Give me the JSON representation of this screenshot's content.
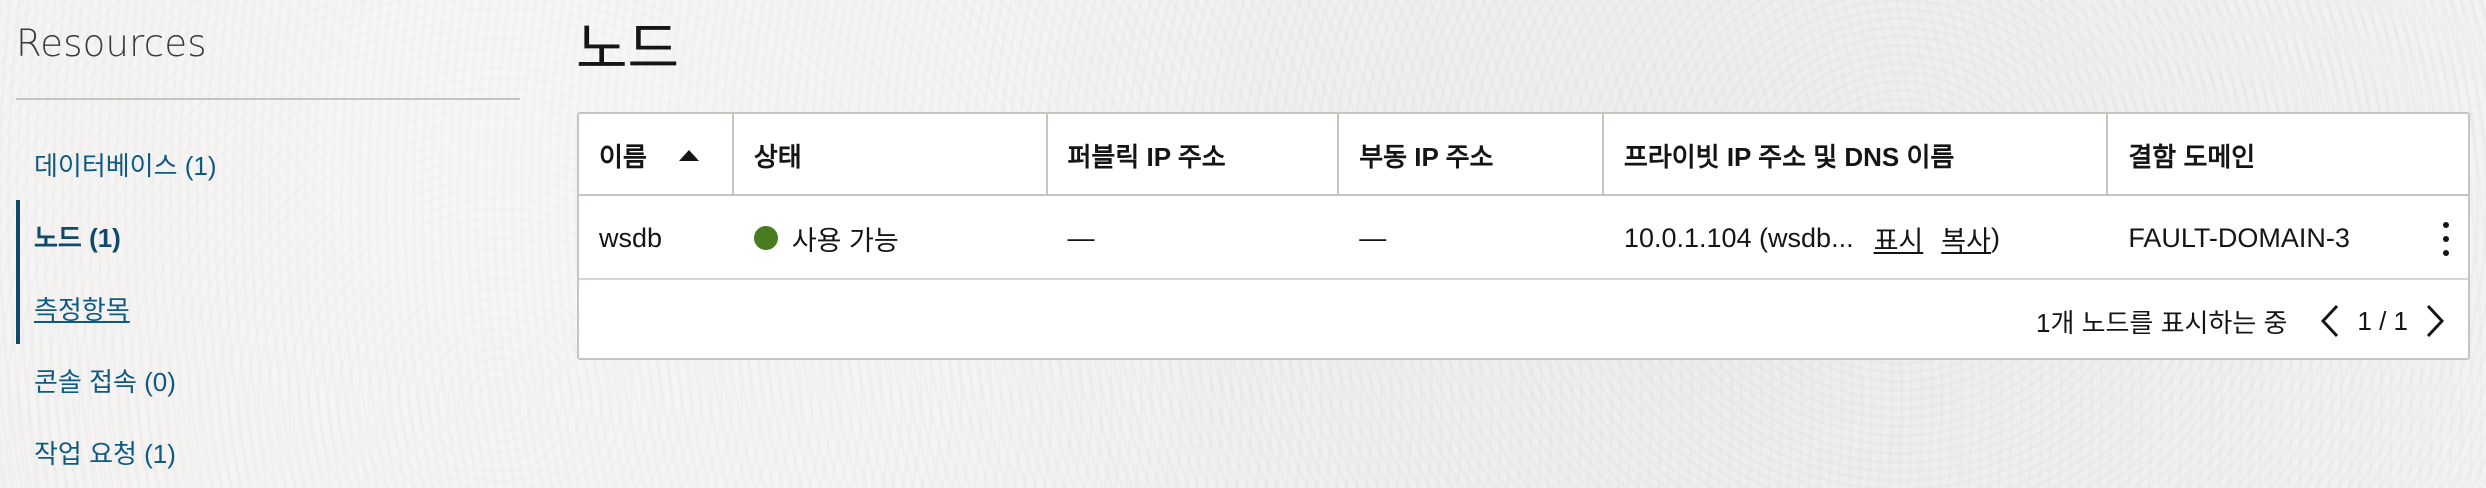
{
  "sidebar": {
    "title": "Resources",
    "items": [
      {
        "label": "데이터베이스 (1)"
      },
      {
        "label": "노드 (1)"
      },
      {
        "label": "측정항목"
      },
      {
        "label": "콘솔 접속 (0)"
      },
      {
        "label": "작업 요청 (1)"
      }
    ]
  },
  "main": {
    "title": "노드",
    "table": {
      "columns": [
        "이름",
        "상태",
        "퍼블릭 IP 주소",
        "부동 IP 주소",
        "프라이빗 IP 주소 및 DNS 이름",
        "결함 도메인"
      ],
      "rows": [
        {
          "name": "wsdb",
          "status": "사용 가능",
          "public_ip": "—",
          "floating_ip": "—",
          "private_ip_prefix": "10.0.1.104 (wsdb...",
          "show_label": "표시",
          "copy_label": "복사",
          "private_ip_suffix": ")",
          "fault_domain": "FAULT-DOMAIN-3"
        }
      ],
      "footer": {
        "summary": "1개 노드를 표시하는 중",
        "page": "1 / 1"
      }
    }
  },
  "colors": {
    "accent": "#0f5a80",
    "status_available": "#4b7b21"
  },
  "icons": {
    "sort": "sort-ascending-icon",
    "row_actions": "kebab-menu-icon",
    "prev": "chevron-left-icon",
    "next": "chevron-right-icon"
  }
}
